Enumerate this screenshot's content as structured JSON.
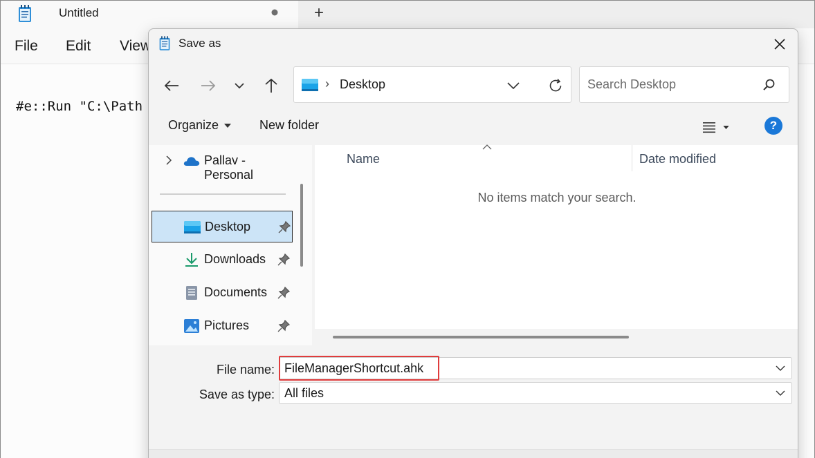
{
  "notepad": {
    "tab_title": "Untitled",
    "new_tab": "+",
    "menu": [
      "File",
      "Edit",
      "View"
    ],
    "code_line": "#e::Run \"C:\\Path"
  },
  "dialog": {
    "title": "Save as",
    "address": {
      "separator": "›",
      "location": "Desktop"
    },
    "search": {
      "placeholder": "Search Desktop",
      "value": ""
    },
    "toolbar": {
      "organize": "Organize",
      "new_folder": "New folder",
      "help": "?"
    },
    "nav": {
      "root": "Pallav - Personal",
      "items": [
        {
          "label": "Desktop",
          "icon": "desktop-folder-icon",
          "selected": true
        },
        {
          "label": "Downloads",
          "icon": "download-icon"
        },
        {
          "label": "Documents",
          "icon": "documents-icon"
        },
        {
          "label": "Pictures",
          "icon": "pictures-icon"
        }
      ]
    },
    "columns": {
      "name": "Name",
      "date_modified": "Date modified"
    },
    "empty_message": "No items match your search.",
    "file_name": {
      "label": "File name:",
      "value": "FileManagerShortcut.ahk"
    },
    "save_as_type": {
      "label": "Save as type:",
      "value": "All files"
    },
    "colors": {
      "accent": "#1a78d8",
      "selection": "#cce4f7",
      "highlight": "#e03c3c",
      "onedrive": "#1e73c9"
    }
  }
}
